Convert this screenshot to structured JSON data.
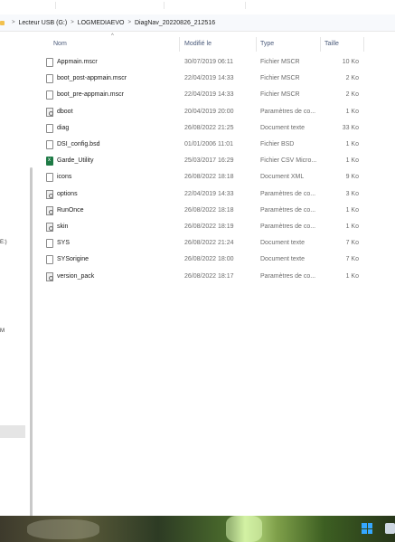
{
  "breadcrumb": {
    "items": [
      "Lecteur USB (G:)",
      "LOGMEDIAEVO",
      "DiagNav_20220826_212516"
    ]
  },
  "sidebar": {
    "fragments": [
      "E:)",
      "M"
    ]
  },
  "columns": {
    "name": "Nom",
    "modified": "Modifié le",
    "type": "Type",
    "size": "Taille"
  },
  "files": [
    {
      "name": "Appmain.mscr",
      "date": "30/07/2019 06:11",
      "type": "Fichier MSCR",
      "size": "10 Ko",
      "icon": "document-icon"
    },
    {
      "name": "boot_post-appmain.mscr",
      "date": "22/04/2019 14:33",
      "type": "Fichier MSCR",
      "size": "2 Ko",
      "icon": "document-icon"
    },
    {
      "name": "boot_pre-appmain.mscr",
      "date": "22/04/2019 14:33",
      "type": "Fichier MSCR",
      "size": "2 Ko",
      "icon": "document-icon"
    },
    {
      "name": "dboot",
      "date": "20/04/2019 20:00",
      "type": "Paramètres de co...",
      "size": "1 Ko",
      "icon": "settings-file-icon"
    },
    {
      "name": "diag",
      "date": "26/08/2022 21:25",
      "type": "Document texte",
      "size": "33 Ko",
      "icon": "text-file-icon"
    },
    {
      "name": "DSI_config.bsd",
      "date": "01/01/2006 11:01",
      "type": "Fichier BSD",
      "size": "1 Ko",
      "icon": "document-icon"
    },
    {
      "name": "Garde_Utility",
      "date": "25/03/2017 16:29",
      "type": "Fichier CSV Micro...",
      "size": "1 Ko",
      "icon": "excel-csv-icon"
    },
    {
      "name": "icons",
      "date": "26/08/2022 18:18",
      "type": "Document XML",
      "size": "9 Ko",
      "icon": "document-icon"
    },
    {
      "name": "options",
      "date": "22/04/2019 14:33",
      "type": "Paramètres de co...",
      "size": "3 Ko",
      "icon": "settings-file-icon"
    },
    {
      "name": "RunOnce",
      "date": "26/08/2022 18:18",
      "type": "Paramètres de co...",
      "size": "1 Ko",
      "icon": "settings-file-icon"
    },
    {
      "name": "skin",
      "date": "26/08/2022 18:19",
      "type": "Paramètres de co...",
      "size": "1 Ko",
      "icon": "settings-file-icon"
    },
    {
      "name": "SYS",
      "date": "26/08/2022 21:24",
      "type": "Document texte",
      "size": "7 Ko",
      "icon": "text-file-icon"
    },
    {
      "name": "SYSorigine",
      "date": "26/08/2022 18:00",
      "type": "Document texte",
      "size": "7 Ko",
      "icon": "text-file-icon"
    },
    {
      "name": "version_pack",
      "date": "26/08/2022 18:17",
      "type": "Paramètres de co...",
      "size": "1 Ko",
      "icon": "settings-file-icon"
    }
  ]
}
